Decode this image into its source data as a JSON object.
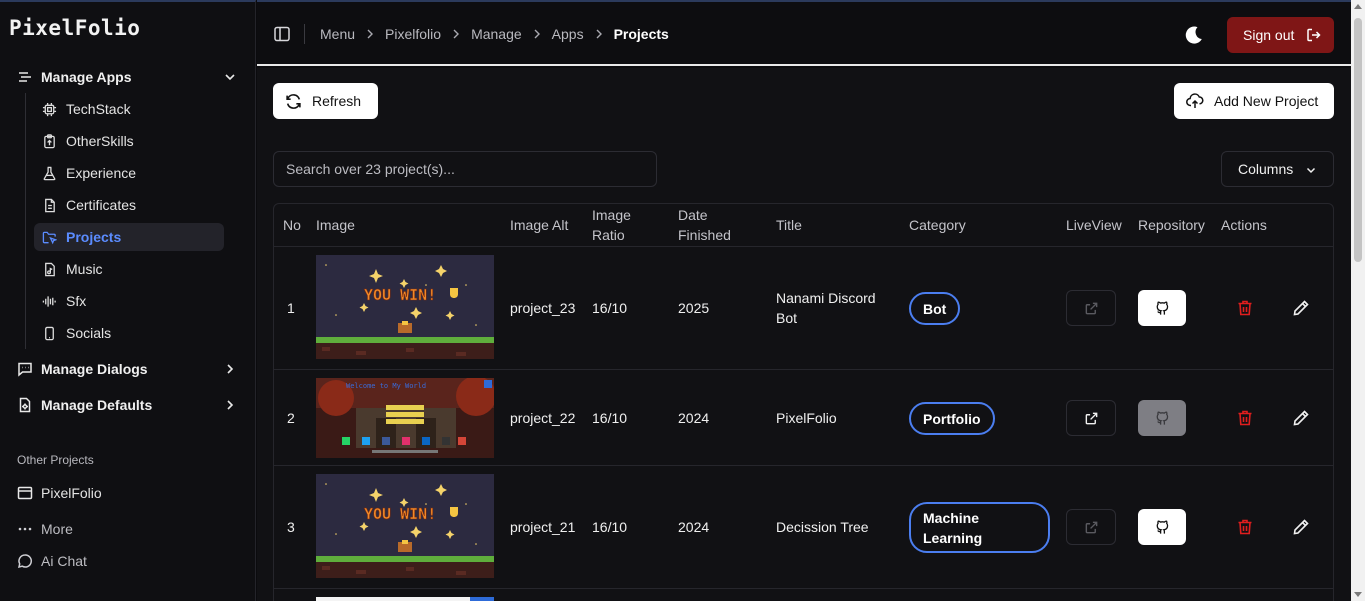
{
  "brand": "PixelFolio",
  "sidebar": {
    "manage_apps": "Manage Apps",
    "items": [
      "TechStack",
      "OtherSkills",
      "Experience",
      "Certificates",
      "Projects",
      "Music",
      "Sfx",
      "Socials"
    ],
    "manage_dialogs": "Manage Dialogs",
    "manage_defaults": "Manage Defaults",
    "other_projects_label": "Other Projects",
    "other": [
      "PixelFolio",
      "More",
      "Ai Chat"
    ]
  },
  "header": {
    "breadcrumbs": [
      "Menu",
      "Pixelfolio",
      "Manage",
      "Apps"
    ],
    "current": "Projects",
    "signout": "Sign out"
  },
  "toolbar": {
    "refresh": "Refresh",
    "add_new": "Add New Project",
    "search_placeholder": "Search over 23 project(s)...",
    "columns": "Columns"
  },
  "table": {
    "headers": {
      "no": "No",
      "image": "Image",
      "image_alt": "Image Alt",
      "image_ratio": "Image Ratio",
      "date_finished": "Date Finished",
      "title": "Title",
      "category": "Category",
      "liveview": "LiveView",
      "repository": "Repository",
      "actions": "Actions"
    },
    "rows": [
      {
        "no": "1",
        "image": "you-win-game-screen",
        "image_alt": "project_23",
        "ratio": "16/10",
        "date": "2025",
        "title": "Nanami Discord Bot",
        "category": "Bot",
        "liveview_enabled": false,
        "repo_enabled": true
      },
      {
        "no": "2",
        "image": "pixelfolio-homepage-screen",
        "image_alt": "project_22",
        "ratio": "16/10",
        "date": "2024",
        "title": "PixelFolio",
        "category": "Portfolio",
        "liveview_enabled": true,
        "repo_enabled": false
      },
      {
        "no": "3",
        "image": "you-win-game-screen",
        "image_alt": "project_21",
        "ratio": "16/10",
        "date": "2024",
        "title": "Decission Tree",
        "category": "Machine Learning",
        "liveview_enabled": false,
        "repo_enabled": true
      }
    ]
  },
  "colors": {
    "accent": "#5b8cff",
    "pill_border": "#4b7ef0",
    "signout_bg": "#7f1616",
    "delete": "#e01e1e"
  }
}
